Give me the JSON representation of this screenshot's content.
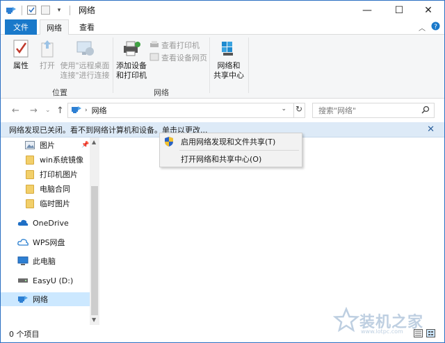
{
  "window": {
    "title": "网络",
    "controls": {
      "minimize": "—",
      "maximize": "☐",
      "close": "✕"
    }
  },
  "ribbon": {
    "tabs": [
      {
        "label": "文件"
      },
      {
        "label": "网络"
      },
      {
        "label": "查看"
      }
    ],
    "buttons": {
      "properties": "属性",
      "open": "打开",
      "remote_line1": "使用\"远程桌面",
      "remote_line2": "连接\"进行连接",
      "view_printers": "查看打印机",
      "view_device_pages": "查看设备网页",
      "add_devices_line1": "添加设备",
      "add_devices_line2": "和打印机",
      "network_center_line1": "网络和",
      "network_center_line2": "共享中心"
    },
    "groups": {
      "location": "位置",
      "network": "网络"
    }
  },
  "address": {
    "path": "网络",
    "search_placeholder": "搜索\"网络\""
  },
  "infobar": {
    "text": "网络发现已关闭。看不到网络计算机和设备。单击以更改..."
  },
  "context_menu": {
    "items": [
      {
        "label": "启用网络发现和文件共享(T)"
      },
      {
        "label": "打开网络和共享中心(O)"
      }
    ]
  },
  "navpane": {
    "items": [
      {
        "label": "图片"
      },
      {
        "label": "win系统镜像"
      },
      {
        "label": "打印机图片"
      },
      {
        "label": "电脑合同"
      },
      {
        "label": "临时图片"
      },
      {
        "label": "OneDrive"
      },
      {
        "label": "WPS网盘"
      },
      {
        "label": "此电脑"
      },
      {
        "label": "EasyU (D:)"
      },
      {
        "label": "网络"
      }
    ]
  },
  "status": {
    "items_count": "0 个项目"
  },
  "watermark": {
    "text": "装机之家",
    "sub": "www.lotpc.com"
  },
  "colors": {
    "accent": "#1979ca",
    "infobar": "#ddeaf7",
    "selected": "#cce8ff"
  }
}
